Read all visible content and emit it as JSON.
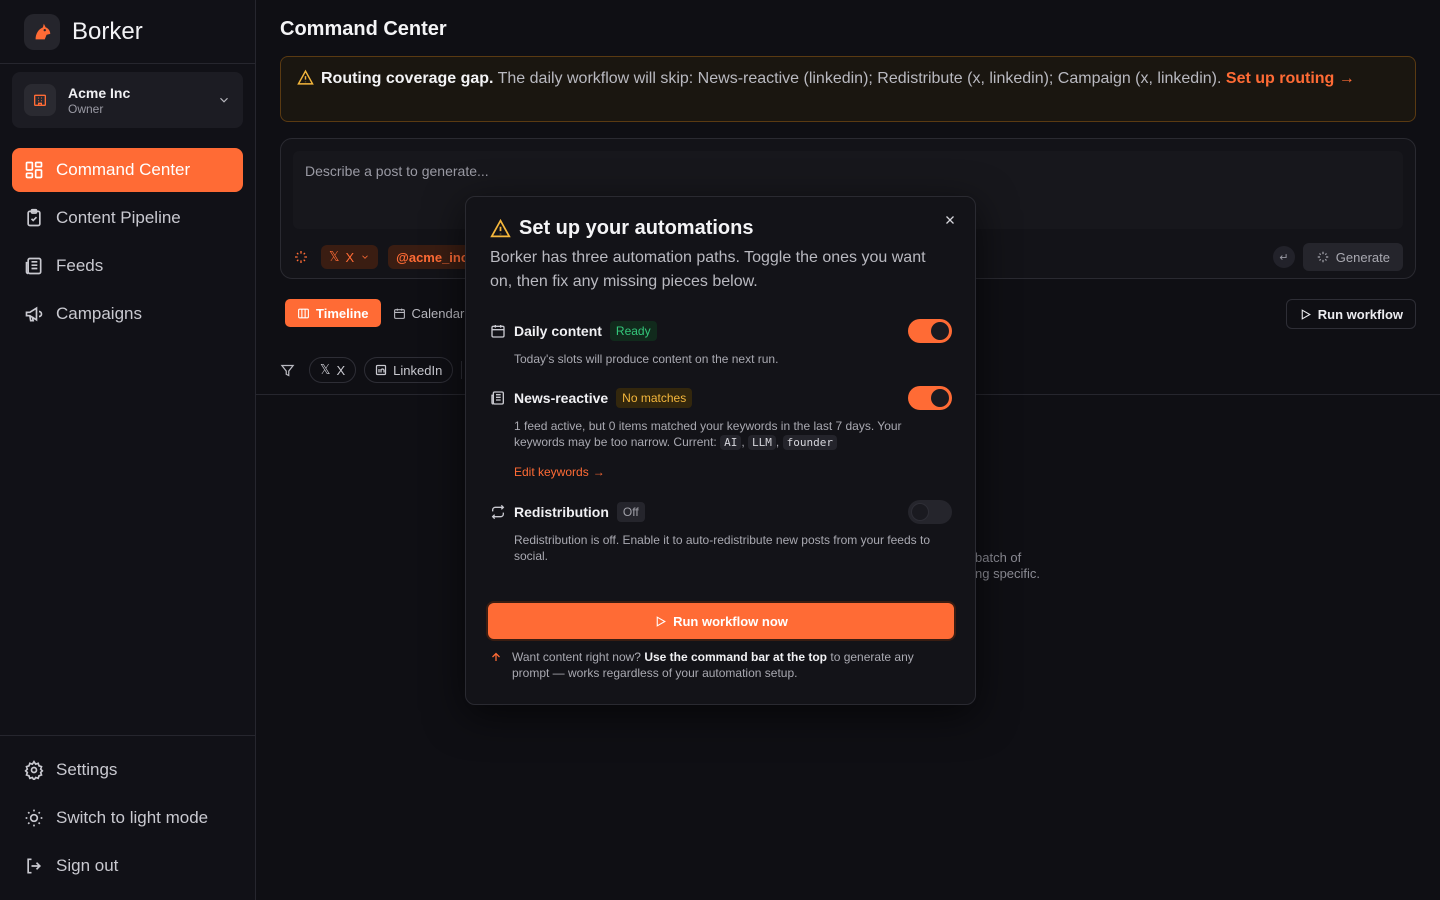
{
  "app": {
    "name": "Borker"
  },
  "org": {
    "name": "Acme Inc",
    "role": "Owner"
  },
  "nav": [
    {
      "label": "Command Center",
      "icon": "dashboard-icon",
      "active": true
    },
    {
      "label": "Content Pipeline",
      "icon": "clipboard-icon"
    },
    {
      "label": "Feeds",
      "icon": "newspaper-icon"
    },
    {
      "label": "Campaigns",
      "icon": "megaphone-icon"
    }
  ],
  "bottom_nav": [
    {
      "label": "Settings",
      "icon": "gear-icon"
    },
    {
      "label": "Switch to light mode",
      "icon": "sun-icon"
    },
    {
      "label": "Sign out",
      "icon": "sign-out-icon"
    }
  ],
  "page": {
    "title": "Command Center"
  },
  "alert": {
    "title": "Routing coverage gap.",
    "text": "The daily workflow will skip: News-reactive (linkedin); Redistribute (x, linkedin); Campaign (x, linkedin).",
    "link": "Set up routing",
    "arrow": "→"
  },
  "composer": {
    "placeholder": "Describe a post to generate...",
    "platform": "X",
    "account": "@acme_inc",
    "enter_glyph": "↵",
    "generate_label": "Generate"
  },
  "views": {
    "timeline": "Timeline",
    "calendar": "Calendar"
  },
  "run_workflow_label": "Run workflow",
  "filters": {
    "x": "X",
    "linkedin": "LinkedIn"
  },
  "behind_text": {
    "line1": "batch of",
    "line2": "ng specific."
  },
  "modal": {
    "title": "Set up your automations",
    "description": "Borker has three automation paths. Toggle the ones you want on, then fix any missing pieces below.",
    "automations": {
      "daily": {
        "name": "Daily content",
        "badge": "Ready",
        "enabled": true,
        "description": "Today's slots will produce content on the next run."
      },
      "news": {
        "name": "News-reactive",
        "badge": "No matches",
        "enabled": true,
        "description": "1 feed active, but 0 items matched your keywords in the last 7 days. Your keywords may be too narrow. Current:",
        "keywords": [
          "AI",
          "LLM",
          "founder"
        ],
        "edit_link": "Edit keywords",
        "arrow": "→"
      },
      "redistribution": {
        "name": "Redistribution",
        "badge": "Off",
        "enabled": false,
        "description": "Redistribution is off. Enable it to auto-redistribute new posts from your feeds to social."
      }
    },
    "run_now_label": "Run workflow now",
    "hint": {
      "prefix": "Want content right now?",
      "bold": "Use the command bar at the top",
      "suffix": "to generate any prompt — works regardless of your automation setup."
    }
  },
  "colors": {
    "accent": "#ff6b35",
    "ready": "#34c77b",
    "warning": "#f5b73c",
    "background": "#0f0f14"
  }
}
